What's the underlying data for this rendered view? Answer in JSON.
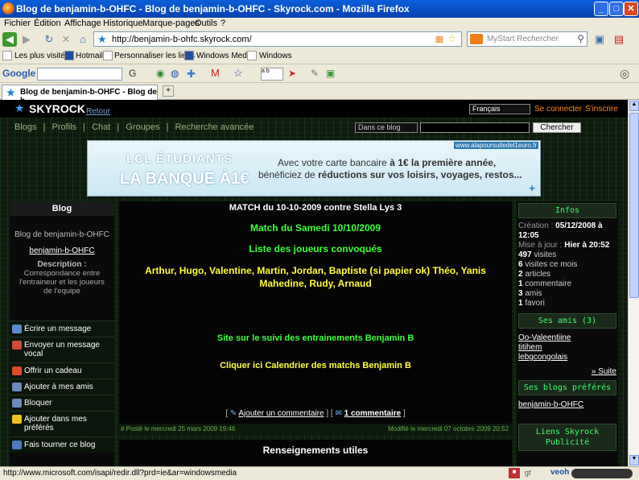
{
  "window": {
    "title": "Blog de benjamin-b-OHFC - Blog de benjamin-b-OHFC - Skyrock.com - Mozilla Firefox"
  },
  "menu": [
    "Fichier",
    "Édition",
    "Affichage",
    "Historique",
    "Marque-pages",
    "Outils",
    "?"
  ],
  "nav": {
    "url": "http://benjamin-b-ohfc.skyrock.com/",
    "search_placeholder": "MyStart Rechercher"
  },
  "bookmarks": [
    "Les plus visités",
    "Hotmail",
    "Personnaliser les liens",
    "Windows Media",
    "Windows"
  ],
  "google": {
    "label": "Google"
  },
  "tab": {
    "title": "Blog de benjamin-b-OHFC - Blog de b..."
  },
  "sky": {
    "logo": "SKYROCK",
    "back": "Retour",
    "lang": "Français",
    "connect": "Se connecter",
    "signup": "S'inscrire",
    "nav": [
      "Blogs",
      "Profils",
      "Chat",
      "Groupes",
      "Recherche avancée"
    ],
    "search_scope": "Dans ce blog",
    "search_button": "Chercher"
  },
  "banner": {
    "top_url": "www.alapoursuitedel1euro.fr",
    "brand_line1": "LCL ÉTUDIANTS",
    "brand_line2": "LA BANQUE À1€",
    "text_line1_a": "Avec votre carte bancaire ",
    "text_line1_b": "à 1€ la première année,",
    "text_line2_a": "bénéficiez de ",
    "text_line2_b": "réductions sur vos loisirs, voyages, restos...",
    "plus": "+"
  },
  "left": {
    "heading": "Blog",
    "blog_title": "Blog de benjamin-b-OHFC",
    "username": "benjamin-b-OHFC",
    "desc_label": "Description :",
    "desc_text": "Correspondance entre l'entraineur et les joueurs de l'equipe",
    "actions": [
      "Écrire un message",
      "Envoyer un message vocal",
      "Offrir un cadeau",
      "Ajouter à mes amis",
      "Bloquer",
      "Ajouter dans mes préférés",
      "Fais tourner ce blog"
    ]
  },
  "post": {
    "title": "MATCH du 10-10-2009 contre Stella Lys 3",
    "line1": "Match du Samedi 10/10/2009",
    "line2": "Liste des joueurs convoqués",
    "line3": "Arthur, Hugo, Valentine, Martin, Jordan, Baptiste (si papier ok) Théo, Yanis Mahedine, Rudy, Arnaud",
    "link1": "Site sur le suivi des entrainements Benjamin B",
    "link2": "Cliquer ici Calendrier des matchs Benjamin B",
    "add_comment": "Ajouter un commentaire",
    "comment_count": "1 commentaire",
    "posted": "# Posté le mercredi 25 mars 2009 19:46",
    "modified": "Modifié le mercredi 07 octobre 2009 20:52",
    "next_heading": "Renseignements utiles"
  },
  "right": {
    "infos_heading": "Infos",
    "creation_label": "Création :",
    "creation_value": "05/12/2008 à 12:05",
    "update_label": "Mise à jour :",
    "update_value": "Hier à 20:52",
    "stats": [
      {
        "num": "497",
        "label": "visites"
      },
      {
        "num": "6",
        "label": "visites ce mois"
      },
      {
        "num": "2",
        "label": "articles"
      },
      {
        "num": "1",
        "label": "commentaire"
      },
      {
        "num": "3",
        "label": "amis"
      },
      {
        "num": "1",
        "label": "favori"
      }
    ],
    "friends_heading": "Ses amis (3)",
    "friends": [
      "Oo-Valeentiine",
      "titihem",
      "lebgcongolais"
    ],
    "more": "» Suite",
    "blogs_heading": "Ses blogs préférés",
    "blogs": [
      "benjamin-b-OHFC"
    ],
    "links_heading": "Liens Skyrock",
    "links_sub": "Publicité"
  },
  "status": {
    "url": "http://www.microsoft.com/isapi/redir.dll?prd=ie&ar=windowsmedia",
    "veoh": "veoh"
  },
  "colors": {
    "post_green": "#39ff3a",
    "post_yellow": "#ffff33",
    "link_orange": "#ff8a1a"
  }
}
